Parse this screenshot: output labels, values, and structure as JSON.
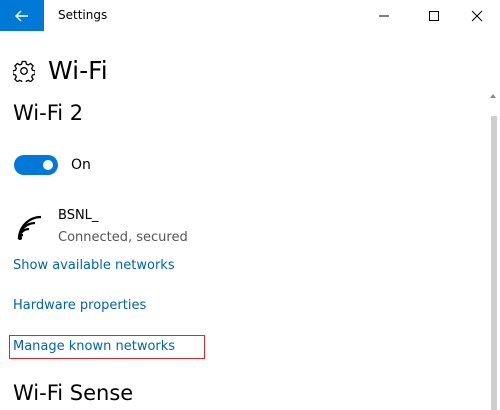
{
  "window": {
    "title": "Settings",
    "controls": [
      "minimize",
      "maximize",
      "close"
    ]
  },
  "page": {
    "title": "Wi-Fi",
    "icon": "gear-icon"
  },
  "section": {
    "title": "Wi-Fi 2"
  },
  "toggle": {
    "state": "on",
    "label": "On"
  },
  "network": {
    "name": "BSNL_",
    "status": "Connected, secured",
    "icon": "wifi-signal-icon"
  },
  "links": {
    "available": "Show available networks",
    "hardware": "Hardware properties",
    "manage": "Manage known networks"
  },
  "section2": {
    "title": "Wi-Fi Sense"
  },
  "colors": {
    "accent": "#0078d7",
    "link": "#0063b1",
    "highlight": "#e0262b"
  }
}
